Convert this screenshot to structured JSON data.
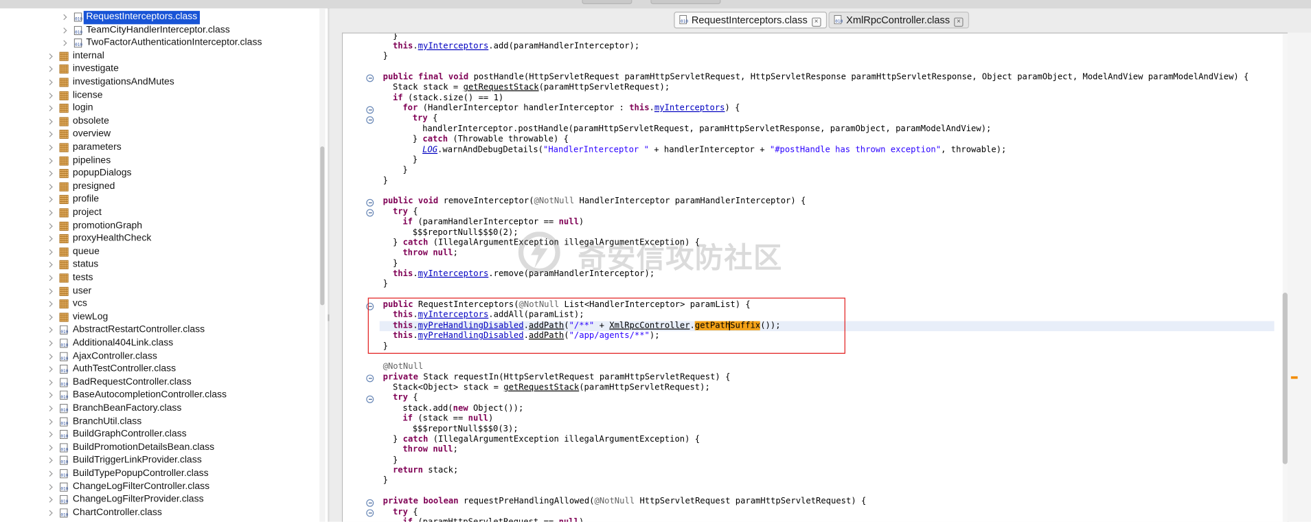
{
  "explorer": {
    "items": [
      {
        "label": "RequestInterceptors.class",
        "kind": "class",
        "depth": 2,
        "selected": true
      },
      {
        "label": "TeamCityHandlerInterceptor.class",
        "kind": "class",
        "depth": 2
      },
      {
        "label": "TwoFactorAuthenticationInterceptor.class",
        "kind": "class",
        "depth": 2
      },
      {
        "label": "internal",
        "kind": "package",
        "depth": 1
      },
      {
        "label": "investigate",
        "kind": "package",
        "depth": 1
      },
      {
        "label": "investigationsAndMutes",
        "kind": "package",
        "depth": 1
      },
      {
        "label": "license",
        "kind": "package",
        "depth": 1
      },
      {
        "label": "login",
        "kind": "package",
        "depth": 1
      },
      {
        "label": "obsolete",
        "kind": "package",
        "depth": 1
      },
      {
        "label": "overview",
        "kind": "package",
        "depth": 1
      },
      {
        "label": "parameters",
        "kind": "package",
        "depth": 1
      },
      {
        "label": "pipelines",
        "kind": "package",
        "depth": 1
      },
      {
        "label": "popupDialogs",
        "kind": "package",
        "depth": 1
      },
      {
        "label": "presigned",
        "kind": "package",
        "depth": 1
      },
      {
        "label": "profile",
        "kind": "package",
        "depth": 1
      },
      {
        "label": "project",
        "kind": "package",
        "depth": 1
      },
      {
        "label": "promotionGraph",
        "kind": "package",
        "depth": 1
      },
      {
        "label": "proxyHealthCheck",
        "kind": "package",
        "depth": 1
      },
      {
        "label": "queue",
        "kind": "package",
        "depth": 1
      },
      {
        "label": "status",
        "kind": "package",
        "depth": 1
      },
      {
        "label": "tests",
        "kind": "package",
        "depth": 1
      },
      {
        "label": "user",
        "kind": "package",
        "depth": 1
      },
      {
        "label": "vcs",
        "kind": "package",
        "depth": 1
      },
      {
        "label": "viewLog",
        "kind": "package",
        "depth": 1
      },
      {
        "label": "AbstractRestartController.class",
        "kind": "class",
        "depth": 1
      },
      {
        "label": "Additional404Link.class",
        "kind": "class",
        "depth": 1
      },
      {
        "label": "AjaxController.class",
        "kind": "class",
        "depth": 1
      },
      {
        "label": "AuthTestController.class",
        "kind": "class",
        "depth": 1
      },
      {
        "label": "BadRequestController.class",
        "kind": "class",
        "depth": 1
      },
      {
        "label": "BaseAutocompletionController.class",
        "kind": "class",
        "depth": 1
      },
      {
        "label": "BranchBeanFactory.class",
        "kind": "class",
        "depth": 1
      },
      {
        "label": "BranchUtil.class",
        "kind": "class",
        "depth": 1
      },
      {
        "label": "BuildGraphController.class",
        "kind": "class",
        "depth": 1
      },
      {
        "label": "BuildPromotionDetailsBean.class",
        "kind": "class",
        "depth": 1
      },
      {
        "label": "BuildTriggerLinkProvider.class",
        "kind": "class",
        "depth": 1
      },
      {
        "label": "BuildTypePopupController.class",
        "kind": "class",
        "depth": 1
      },
      {
        "label": "ChangeLogFilterController.class",
        "kind": "class",
        "depth": 1
      },
      {
        "label": "ChangeLogFilterProvider.class",
        "kind": "class",
        "depth": 1
      },
      {
        "label": "ChartController.class",
        "kind": "class",
        "depth": 1
      }
    ]
  },
  "tabs": [
    {
      "label": "RequestInterceptors.class",
      "active": true
    },
    {
      "label": "XmlRpcController.class",
      "active": false
    }
  ],
  "watermark": {
    "text": "奇安信攻防社区"
  },
  "code": {
    "highlight_box_lines": [
      26,
      31
    ],
    "current_line": 28,
    "lines": [
      {
        "indent": 1,
        "fold": false,
        "segs": [
          [
            "p",
            "}"
          ]
        ]
      },
      {
        "indent": 1,
        "fold": false,
        "segs": [
          [
            "kw",
            "this"
          ],
          [
            "p",
            "."
          ],
          [
            "fld",
            "myInterceptors"
          ],
          [
            "p",
            ".add(paramHandlerInterceptor);"
          ]
        ]
      },
      {
        "indent": 0,
        "fold": false,
        "segs": [
          [
            "p",
            "}"
          ]
        ]
      },
      {
        "indent": 0,
        "fold": false,
        "segs": []
      },
      {
        "indent": 0,
        "fold": true,
        "segs": [
          [
            "kw",
            "public final void"
          ],
          [
            "p",
            " postHandle(HttpServletRequest paramHttpServletRequest, HttpServletResponse paramHttpServletResponse, Object paramObject, ModelAndView paramModelAndView) {"
          ]
        ]
      },
      {
        "indent": 1,
        "fold": false,
        "segs": [
          [
            "p",
            "Stack stack = "
          ],
          [
            "mth",
            "getRequestStack"
          ],
          [
            "p",
            "(paramHttpServletRequest);"
          ]
        ]
      },
      {
        "indent": 1,
        "fold": false,
        "segs": [
          [
            "kw",
            "if"
          ],
          [
            "p",
            " (stack.size() == 1)"
          ]
        ]
      },
      {
        "indent": 2,
        "fold": true,
        "segs": [
          [
            "kw",
            "for"
          ],
          [
            "p",
            " (HandlerInterceptor handlerInterceptor : "
          ],
          [
            "kw",
            "this"
          ],
          [
            "p",
            "."
          ],
          [
            "fld",
            "myInterceptors"
          ],
          [
            "p",
            ") {"
          ]
        ]
      },
      {
        "indent": 3,
        "fold": true,
        "segs": [
          [
            "kw",
            "try"
          ],
          [
            "p",
            " {"
          ]
        ]
      },
      {
        "indent": 4,
        "fold": false,
        "segs": [
          [
            "p",
            "handlerInterceptor.postHandle(paramHttpServletRequest, paramHttpServletResponse, paramObject, paramModelAndView);"
          ]
        ]
      },
      {
        "indent": 3,
        "fold": false,
        "segs": [
          [
            "p",
            "} "
          ],
          [
            "kw",
            "catch"
          ],
          [
            "p",
            " (Throwable throwable) {"
          ]
        ]
      },
      {
        "indent": 4,
        "fold": false,
        "segs": [
          [
            "fs",
            "LOG"
          ],
          [
            "p",
            ".warnAndDebugDetails("
          ],
          [
            "str",
            "\"HandlerInterceptor \""
          ],
          [
            "p",
            " + handlerInterceptor + "
          ],
          [
            "str",
            "\"#postHandle has thrown exception\""
          ],
          [
            "p",
            ", throwable);"
          ]
        ]
      },
      {
        "indent": 3,
        "fold": false,
        "segs": [
          [
            "p",
            "}"
          ]
        ]
      },
      {
        "indent": 2,
        "fold": false,
        "segs": [
          [
            "p",
            "}"
          ]
        ]
      },
      {
        "indent": 0,
        "fold": false,
        "segs": [
          [
            "p",
            "}"
          ]
        ]
      },
      {
        "indent": 0,
        "fold": false,
        "segs": []
      },
      {
        "indent": 0,
        "fold": true,
        "segs": [
          [
            "kw",
            "public void"
          ],
          [
            "p",
            " removeInterceptor("
          ],
          [
            "ann",
            "@NotNull"
          ],
          [
            "p",
            " HandlerInterceptor paramHandlerInterceptor) {"
          ]
        ]
      },
      {
        "indent": 1,
        "fold": true,
        "segs": [
          [
            "kw",
            "try"
          ],
          [
            "p",
            " {"
          ]
        ]
      },
      {
        "indent": 2,
        "fold": false,
        "segs": [
          [
            "kw",
            "if"
          ],
          [
            "p",
            " (paramHandlerInterceptor == "
          ],
          [
            "kw",
            "null"
          ],
          [
            "p",
            ")"
          ]
        ]
      },
      {
        "indent": 3,
        "fold": false,
        "segs": [
          [
            "p",
            "$$$reportNull$$$0(2);"
          ]
        ]
      },
      {
        "indent": 1,
        "fold": false,
        "segs": [
          [
            "p",
            "} "
          ],
          [
            "kw",
            "catch"
          ],
          [
            "p",
            " (IllegalArgumentException illegalArgumentException) {"
          ]
        ]
      },
      {
        "indent": 2,
        "fold": false,
        "segs": [
          [
            "kw",
            "throw null"
          ],
          [
            "p",
            ";"
          ]
        ]
      },
      {
        "indent": 1,
        "fold": false,
        "segs": [
          [
            "p",
            "}"
          ]
        ]
      },
      {
        "indent": 1,
        "fold": false,
        "segs": [
          [
            "kw",
            "this"
          ],
          [
            "p",
            "."
          ],
          [
            "fld",
            "myInterceptors"
          ],
          [
            "p",
            ".remove(paramHandlerInterceptor);"
          ]
        ]
      },
      {
        "indent": 0,
        "fold": false,
        "segs": [
          [
            "p",
            "}"
          ]
        ]
      },
      {
        "indent": 0,
        "fold": false,
        "segs": []
      },
      {
        "indent": 0,
        "fold": true,
        "segs": [
          [
            "kw",
            "public"
          ],
          [
            "p",
            " RequestInterceptors("
          ],
          [
            "ann",
            "@NotNull"
          ],
          [
            "p",
            " List<HandlerInterceptor> paramList) {"
          ]
        ]
      },
      {
        "indent": 1,
        "fold": false,
        "segs": [
          [
            "kw",
            "this"
          ],
          [
            "p",
            "."
          ],
          [
            "fld",
            "myInterceptors"
          ],
          [
            "p",
            ".addAll(paramList);"
          ]
        ]
      },
      {
        "indent": 1,
        "fold": false,
        "segs": [
          [
            "kw",
            "this"
          ],
          [
            "p",
            "."
          ],
          [
            "fld",
            "myPreHandlingDisabled"
          ],
          [
            "p",
            "."
          ],
          [
            "mth",
            "addPath"
          ],
          [
            "p",
            "("
          ],
          [
            "str",
            "\"/**\""
          ],
          [
            "p",
            " + "
          ],
          [
            "mth",
            "XmlRpcController"
          ],
          [
            "p",
            "."
          ],
          [
            "mark",
            "getPath"
          ],
          [
            "caret",
            "S"
          ],
          [
            "mark",
            "uffix"
          ],
          [
            "p",
            "());"
          ]
        ]
      },
      {
        "indent": 1,
        "fold": false,
        "segs": [
          [
            "kw",
            "this"
          ],
          [
            "p",
            "."
          ],
          [
            "fld",
            "myPreHandlingDisabled"
          ],
          [
            "p",
            "."
          ],
          [
            "mth",
            "addPath"
          ],
          [
            "p",
            "("
          ],
          [
            "str",
            "\"/app/agents/**\""
          ],
          [
            "p",
            ");"
          ]
        ]
      },
      {
        "indent": 0,
        "fold": false,
        "segs": [
          [
            "p",
            "}"
          ]
        ]
      },
      {
        "indent": 0,
        "fold": false,
        "segs": []
      },
      {
        "indent": 0,
        "fold": false,
        "segs": [
          [
            "ann",
            "@NotNull"
          ]
        ]
      },
      {
        "indent": 0,
        "fold": true,
        "segs": [
          [
            "kw",
            "private"
          ],
          [
            "p",
            " Stack requestIn(HttpServletRequest paramHttpServletRequest) {"
          ]
        ]
      },
      {
        "indent": 1,
        "fold": false,
        "segs": [
          [
            "p",
            "Stack<Object> stack = "
          ],
          [
            "mth",
            "getRequestStack"
          ],
          [
            "p",
            "(paramHttpServletRequest);"
          ]
        ]
      },
      {
        "indent": 1,
        "fold": true,
        "segs": [
          [
            "kw",
            "try"
          ],
          [
            "p",
            " {"
          ]
        ]
      },
      {
        "indent": 2,
        "fold": false,
        "segs": [
          [
            "p",
            "stack.add("
          ],
          [
            "kw",
            "new"
          ],
          [
            "p",
            " Object());"
          ]
        ]
      },
      {
        "indent": 2,
        "fold": false,
        "segs": [
          [
            "kw",
            "if"
          ],
          [
            "p",
            " (stack == "
          ],
          [
            "kw",
            "null"
          ],
          [
            "p",
            ")"
          ]
        ]
      },
      {
        "indent": 3,
        "fold": false,
        "segs": [
          [
            "p",
            "$$$reportNull$$$0(3);"
          ]
        ]
      },
      {
        "indent": 1,
        "fold": false,
        "segs": [
          [
            "p",
            "} "
          ],
          [
            "kw",
            "catch"
          ],
          [
            "p",
            " (IllegalArgumentException illegalArgumentException) {"
          ]
        ]
      },
      {
        "indent": 2,
        "fold": false,
        "segs": [
          [
            "kw",
            "throw null"
          ],
          [
            "p",
            ";"
          ]
        ]
      },
      {
        "indent": 1,
        "fold": false,
        "segs": [
          [
            "p",
            "}"
          ]
        ]
      },
      {
        "indent": 1,
        "fold": false,
        "segs": [
          [
            "kw",
            "return"
          ],
          [
            "p",
            " stack;"
          ]
        ]
      },
      {
        "indent": 0,
        "fold": false,
        "segs": [
          [
            "p",
            "}"
          ]
        ]
      },
      {
        "indent": 0,
        "fold": false,
        "segs": []
      },
      {
        "indent": 0,
        "fold": true,
        "segs": [
          [
            "kw",
            "private boolean"
          ],
          [
            "p",
            " requestPreHandlingAllowed("
          ],
          [
            "ann",
            "@NotNull"
          ],
          [
            "p",
            " HttpServletRequest paramHttpServletRequest) {"
          ]
        ]
      },
      {
        "indent": 1,
        "fold": true,
        "segs": [
          [
            "kw",
            "try"
          ],
          [
            "p",
            " {"
          ]
        ]
      },
      {
        "indent": 2,
        "fold": false,
        "segs": [
          [
            "kw",
            "if"
          ],
          [
            "p",
            " (paramHttpServletRequest == "
          ],
          [
            "kw",
            "null"
          ],
          [
            "p",
            ")"
          ]
        ]
      }
    ]
  }
}
